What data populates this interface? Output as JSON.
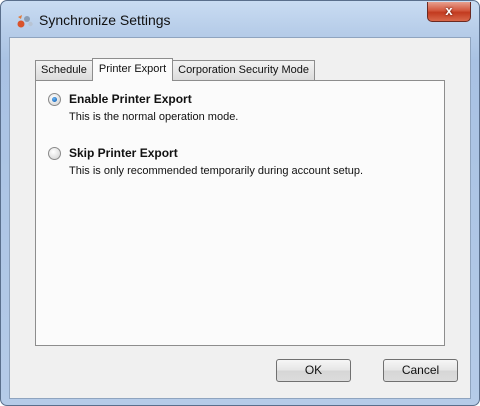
{
  "window": {
    "title": "Synchronize Settings",
    "close_label": "x",
    "app_icon": "sync-settings-icon"
  },
  "tabs": [
    {
      "label": "Schedule",
      "active": false
    },
    {
      "label": "Printer Export",
      "active": true
    },
    {
      "label": "Corporation Security Mode",
      "active": false
    }
  ],
  "options": [
    {
      "label": "Enable Printer Export",
      "description": "This is the normal operation mode.",
      "selected": true
    },
    {
      "label": "Skip Printer Export",
      "description": "This is only recommended temporarily during account setup.",
      "selected": false
    }
  ],
  "buttons": {
    "ok_label": "OK",
    "cancel_label": "Cancel"
  },
  "colors": {
    "title_bar": "#b7cde9",
    "close_button": "#c23a1f",
    "radio_selected": "#1f6fc2"
  }
}
